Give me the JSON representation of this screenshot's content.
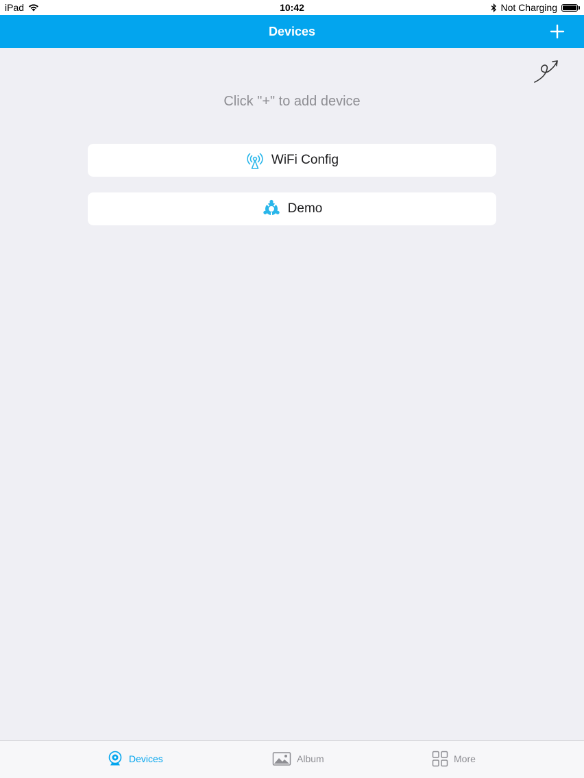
{
  "status_bar": {
    "device": "iPad",
    "time": "10:42",
    "battery_status": "Not Charging"
  },
  "nav": {
    "title": "Devices"
  },
  "main": {
    "hint": "Click \"+\" to add device",
    "options": [
      {
        "label": "WiFi Config",
        "icon": "wifi-antenna-icon"
      },
      {
        "label": "Demo",
        "icon": "demo-icon"
      }
    ]
  },
  "tab_bar": {
    "items": [
      {
        "label": "Devices",
        "icon": "camera-icon",
        "active": true
      },
      {
        "label": "Album",
        "icon": "image-icon",
        "active": false
      },
      {
        "label": "More",
        "icon": "grid-icon",
        "active": false
      }
    ]
  },
  "colors": {
    "accent": "#03a5ee",
    "background": "#efeff4",
    "tab_active": "#03a5ee",
    "tab_inactive": "#8e8e93"
  }
}
